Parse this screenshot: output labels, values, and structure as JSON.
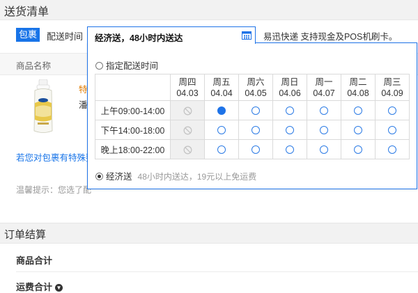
{
  "section1_title": "送货清单",
  "tabs": {
    "package": "包裹",
    "delivery_time": "配送时间"
  },
  "right_note": "易迅快递 支持现金及POS机刷卡。",
  "table_header": {
    "product_name": "商品名称"
  },
  "product": {
    "name_fragment": "特",
    "sub_fragment": "潘"
  },
  "special_link": "若您对包裹有特殊要",
  "tip": "温馨提示：您选了配",
  "section2_title": "订单结算",
  "summary": {
    "goods_total": "商品合计",
    "shipping_total": "运费合计"
  },
  "popup": {
    "tab_label": "经济送，48小时内送达",
    "calendar_icon": "calendar-icon",
    "appointed_label": "指定配送时间",
    "days": [
      {
        "weekday": "周四",
        "date": "04.03"
      },
      {
        "weekday": "周五",
        "date": "04.04"
      },
      {
        "weekday": "周六",
        "date": "04.05"
      },
      {
        "weekday": "周日",
        "date": "04.06"
      },
      {
        "weekday": "周一",
        "date": "04.07"
      },
      {
        "weekday": "周二",
        "date": "04.08"
      },
      {
        "weekday": "周三",
        "date": "04.09"
      }
    ],
    "slots": [
      {
        "label": "上午09:00-14:00",
        "states": [
          "disabled",
          "selected",
          "open",
          "open",
          "open",
          "open",
          "open"
        ]
      },
      {
        "label": "下午14:00-18:00",
        "states": [
          "disabled",
          "open",
          "open",
          "open",
          "open",
          "open",
          "open"
        ]
      },
      {
        "label": "晚上18:00-22:00",
        "states": [
          "disabled",
          "open",
          "open",
          "open",
          "open",
          "open",
          "open"
        ]
      }
    ],
    "economy_label": "经济送",
    "economy_desc": "48小时内送达，19元以上免运费"
  },
  "colors": {
    "accent": "#1e73e8",
    "product_orange": "#e07b00",
    "header_bg": "#f2f2f2"
  }
}
